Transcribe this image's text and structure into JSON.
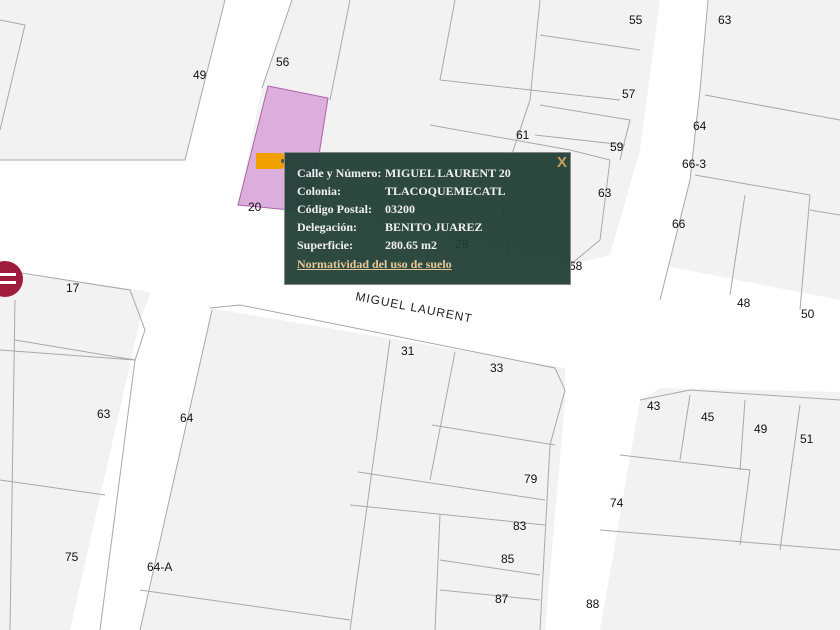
{
  "popup": {
    "rows": [
      {
        "label": "Calle y Número:",
        "value": "MIGUEL LAURENT 20"
      },
      {
        "label": "Colonia:",
        "value": "TLACOQUEMECATL"
      },
      {
        "label": "Código Postal:",
        "value": "03200"
      },
      {
        "label": "Delegación:",
        "value": "BENITO JUAREZ"
      },
      {
        "label": "Superficie:",
        "value": "280.65 m2"
      }
    ],
    "link": "Normatividad del uso de suelo",
    "close": "X"
  },
  "street_name": "MIGUEL LAURENT",
  "lot_numbers": [
    "49",
    "56",
    "20",
    "28",
    "55",
    "63",
    "57",
    "61",
    "59",
    "64",
    "63",
    "66-3",
    "66",
    "68",
    "17",
    "48",
    "50",
    "31",
    "33",
    "43",
    "45",
    "49",
    "51",
    "63",
    "64",
    "79",
    "74",
    "83",
    "75",
    "64-A",
    "85",
    "87",
    "88"
  ],
  "colors": {
    "selected_parcel": "#dcaedc",
    "popup_bg": "#1e3c32",
    "tag": "#f0a000",
    "nav_icon": "#a01c3c"
  }
}
